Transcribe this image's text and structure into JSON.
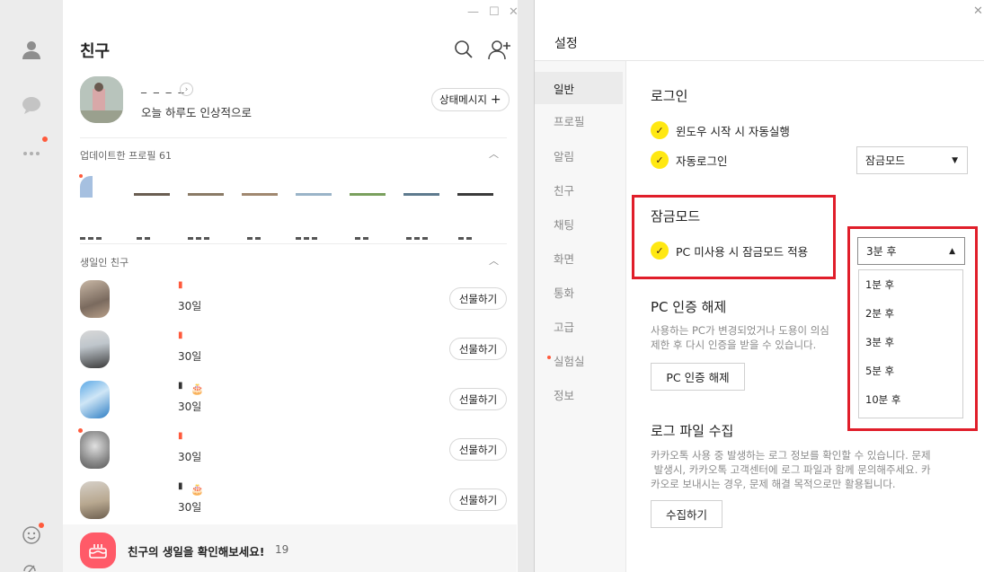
{
  "rail": {
    "icons": [
      "person-icon",
      "chat-icon",
      "more-icon",
      "emoticon-icon",
      "settings-icon"
    ]
  },
  "friends": {
    "title": "친구",
    "window_controls": [
      "—",
      "☐",
      "✕"
    ],
    "me": {
      "name": "_ _ _ _",
      "status_message": "오늘 하루도 인상적으로",
      "status_button": "상태메시지",
      "status_button_plus": "+"
    },
    "updated_section": {
      "label": "업데이트한 프로필",
      "count": "61"
    },
    "birthday_section": {
      "label": "생일인 친구"
    },
    "birthday_rows": [
      {
        "days": "30일",
        "gift": "선물하기",
        "has_cake": false,
        "new_dot": false
      },
      {
        "days": "30일",
        "gift": "선물하기",
        "has_cake": false,
        "new_dot": false
      },
      {
        "days": "30일",
        "gift": "선물하기",
        "has_cake": true,
        "new_dot": false
      },
      {
        "days": "30일",
        "gift": "선물하기",
        "has_cake": false,
        "new_dot": true
      },
      {
        "days": "30일",
        "gift": "선물하기",
        "has_cake": true,
        "new_dot": false
      }
    ],
    "birthday_banner": {
      "text": "친구의 생일을 확인해보세요!",
      "count": "19"
    }
  },
  "settings": {
    "title": "설정",
    "close": "✕",
    "nav": [
      {
        "label": "일반",
        "active": true
      },
      {
        "label": "프로필"
      },
      {
        "label": "알림"
      },
      {
        "label": "친구"
      },
      {
        "label": "채팅"
      },
      {
        "label": "화면"
      },
      {
        "label": "통화"
      },
      {
        "label": "고급"
      },
      {
        "label": "실험실",
        "dot": true
      },
      {
        "label": "정보"
      }
    ],
    "login": {
      "heading": "로그인",
      "auto_start": "윈도우 시작 시 자동실행",
      "auto_login": "자동로그인",
      "auto_login_select": "잠금모드"
    },
    "lock": {
      "heading": "잠금모드",
      "apply_label": "PC 미사용 시 잠금모드 적용",
      "selected": "3분 후",
      "options": [
        "1분 후",
        "2분 후",
        "3분 후",
        "5분 후",
        "10분 후"
      ]
    },
    "pc_auth": {
      "heading": "PC 인증 해제",
      "desc_line1": "사용하는 PC가 변경되었거나 도용이 의심",
      "desc_line2": "제한 후 다시 인증을 받을 수 있습니다.",
      "button": "PC 인증 해제"
    },
    "log": {
      "heading": "로그 파일 수집",
      "desc_line1": "카카오톡 사용 중 발생하는 로그 정보를 확인할 수 있습니다. 문제",
      "desc_line2": " 발생시, 카카오톡 고객센터에 로그 파일과 함께 문의해주세요. 카",
      "desc_line3": "카오로 보내시는 경우, 문제 해결 목적으로만 활용됩니다.",
      "button": "수집하기"
    }
  },
  "colors": {
    "accent_yellow": "#ffe812",
    "highlight_red": "#e01e2a",
    "badge_red": "#ff5a3c",
    "birthday_icon": "#ff5a68"
  }
}
